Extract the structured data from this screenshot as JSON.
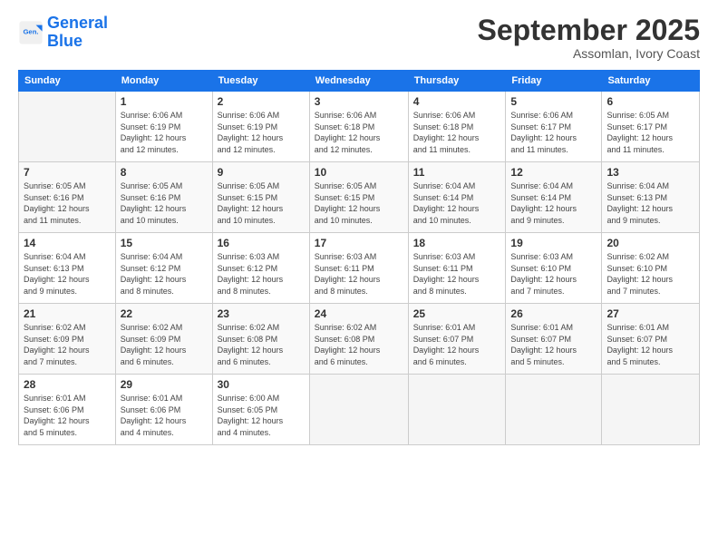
{
  "logo": {
    "line1": "General",
    "line2": "Blue"
  },
  "header": {
    "month": "September 2025",
    "location": "Assomlan, Ivory Coast"
  },
  "days_of_week": [
    "Sunday",
    "Monday",
    "Tuesday",
    "Wednesday",
    "Thursday",
    "Friday",
    "Saturday"
  ],
  "weeks": [
    [
      {
        "num": "",
        "info": ""
      },
      {
        "num": "1",
        "info": "Sunrise: 6:06 AM\nSunset: 6:19 PM\nDaylight: 12 hours\nand 12 minutes."
      },
      {
        "num": "2",
        "info": "Sunrise: 6:06 AM\nSunset: 6:19 PM\nDaylight: 12 hours\nand 12 minutes."
      },
      {
        "num": "3",
        "info": "Sunrise: 6:06 AM\nSunset: 6:18 PM\nDaylight: 12 hours\nand 12 minutes."
      },
      {
        "num": "4",
        "info": "Sunrise: 6:06 AM\nSunset: 6:18 PM\nDaylight: 12 hours\nand 11 minutes."
      },
      {
        "num": "5",
        "info": "Sunrise: 6:06 AM\nSunset: 6:17 PM\nDaylight: 12 hours\nand 11 minutes."
      },
      {
        "num": "6",
        "info": "Sunrise: 6:05 AM\nSunset: 6:17 PM\nDaylight: 12 hours\nand 11 minutes."
      }
    ],
    [
      {
        "num": "7",
        "info": "Sunrise: 6:05 AM\nSunset: 6:16 PM\nDaylight: 12 hours\nand 11 minutes."
      },
      {
        "num": "8",
        "info": "Sunrise: 6:05 AM\nSunset: 6:16 PM\nDaylight: 12 hours\nand 10 minutes."
      },
      {
        "num": "9",
        "info": "Sunrise: 6:05 AM\nSunset: 6:15 PM\nDaylight: 12 hours\nand 10 minutes."
      },
      {
        "num": "10",
        "info": "Sunrise: 6:05 AM\nSunset: 6:15 PM\nDaylight: 12 hours\nand 10 minutes."
      },
      {
        "num": "11",
        "info": "Sunrise: 6:04 AM\nSunset: 6:14 PM\nDaylight: 12 hours\nand 10 minutes."
      },
      {
        "num": "12",
        "info": "Sunrise: 6:04 AM\nSunset: 6:14 PM\nDaylight: 12 hours\nand 9 minutes."
      },
      {
        "num": "13",
        "info": "Sunrise: 6:04 AM\nSunset: 6:13 PM\nDaylight: 12 hours\nand 9 minutes."
      }
    ],
    [
      {
        "num": "14",
        "info": "Sunrise: 6:04 AM\nSunset: 6:13 PM\nDaylight: 12 hours\nand 9 minutes."
      },
      {
        "num": "15",
        "info": "Sunrise: 6:04 AM\nSunset: 6:12 PM\nDaylight: 12 hours\nand 8 minutes."
      },
      {
        "num": "16",
        "info": "Sunrise: 6:03 AM\nSunset: 6:12 PM\nDaylight: 12 hours\nand 8 minutes."
      },
      {
        "num": "17",
        "info": "Sunrise: 6:03 AM\nSunset: 6:11 PM\nDaylight: 12 hours\nand 8 minutes."
      },
      {
        "num": "18",
        "info": "Sunrise: 6:03 AM\nSunset: 6:11 PM\nDaylight: 12 hours\nand 8 minutes."
      },
      {
        "num": "19",
        "info": "Sunrise: 6:03 AM\nSunset: 6:10 PM\nDaylight: 12 hours\nand 7 minutes."
      },
      {
        "num": "20",
        "info": "Sunrise: 6:02 AM\nSunset: 6:10 PM\nDaylight: 12 hours\nand 7 minutes."
      }
    ],
    [
      {
        "num": "21",
        "info": "Sunrise: 6:02 AM\nSunset: 6:09 PM\nDaylight: 12 hours\nand 7 minutes."
      },
      {
        "num": "22",
        "info": "Sunrise: 6:02 AM\nSunset: 6:09 PM\nDaylight: 12 hours\nand 6 minutes."
      },
      {
        "num": "23",
        "info": "Sunrise: 6:02 AM\nSunset: 6:08 PM\nDaylight: 12 hours\nand 6 minutes."
      },
      {
        "num": "24",
        "info": "Sunrise: 6:02 AM\nSunset: 6:08 PM\nDaylight: 12 hours\nand 6 minutes."
      },
      {
        "num": "25",
        "info": "Sunrise: 6:01 AM\nSunset: 6:07 PM\nDaylight: 12 hours\nand 6 minutes."
      },
      {
        "num": "26",
        "info": "Sunrise: 6:01 AM\nSunset: 6:07 PM\nDaylight: 12 hours\nand 5 minutes."
      },
      {
        "num": "27",
        "info": "Sunrise: 6:01 AM\nSunset: 6:07 PM\nDaylight: 12 hours\nand 5 minutes."
      }
    ],
    [
      {
        "num": "28",
        "info": "Sunrise: 6:01 AM\nSunset: 6:06 PM\nDaylight: 12 hours\nand 5 minutes."
      },
      {
        "num": "29",
        "info": "Sunrise: 6:01 AM\nSunset: 6:06 PM\nDaylight: 12 hours\nand 4 minutes."
      },
      {
        "num": "30",
        "info": "Sunrise: 6:00 AM\nSunset: 6:05 PM\nDaylight: 12 hours\nand 4 minutes."
      },
      {
        "num": "",
        "info": ""
      },
      {
        "num": "",
        "info": ""
      },
      {
        "num": "",
        "info": ""
      },
      {
        "num": "",
        "info": ""
      }
    ]
  ]
}
